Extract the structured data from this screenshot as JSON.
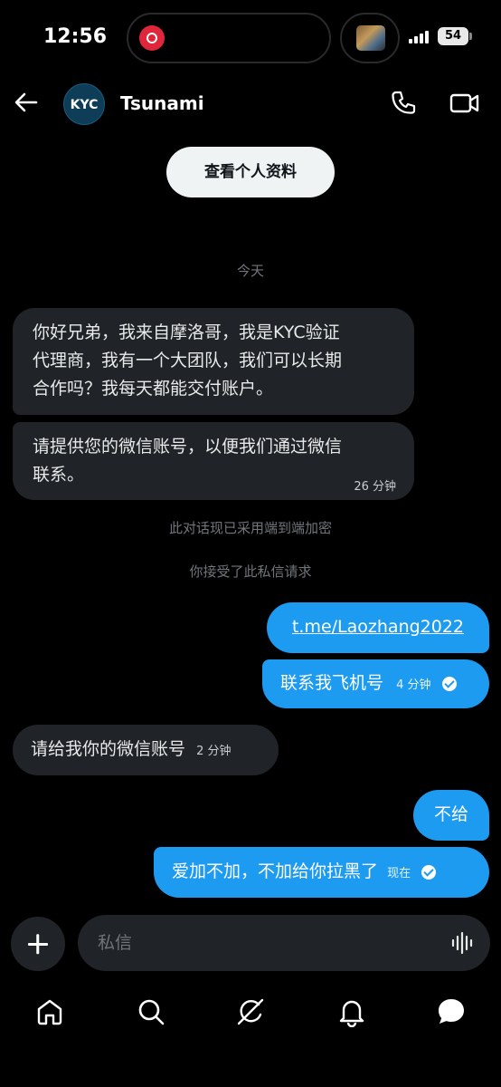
{
  "status_bar": {
    "time": "12:56",
    "battery": "54"
  },
  "header": {
    "avatar_text": "KYC",
    "contact_name": "Tsunami"
  },
  "profile_button_label": "查看个人资料",
  "date_label": "今天",
  "messages": [
    {
      "direction": "in",
      "text": "你好兄弟，我来自摩洛哥，我是KYC验证代理商，我有一个大团队，我们可以长期合作吗？我每天都能交付账户。",
      "lines": [
        "你好兄弟，我来自摩洛哥，我是KYC验证",
        "代理商，我有一个大团队，我们可以长期",
        "合作吗？我每天都能交付账户。"
      ],
      "time": ""
    },
    {
      "direction": "in",
      "text": "请提供您的微信账号，以便我们通过微信联系。",
      "lines": [
        "请提供您的微信账号，以便我们通过微信",
        "联系。"
      ],
      "time": "26 分钟"
    },
    {
      "direction": "out",
      "text": "t.me/Laozhang2022",
      "time": ""
    },
    {
      "direction": "out",
      "text": "联系我飞机号",
      "time": "4 分钟"
    },
    {
      "direction": "in",
      "text": "请给我你的微信账号",
      "time": "2 分钟"
    },
    {
      "direction": "out",
      "text": "不给",
      "time": ""
    },
    {
      "direction": "out",
      "text": "爱加不加，不加给你拉黑了",
      "time": "现在"
    }
  ],
  "system_notices": {
    "encryption": "此对话现已采用端到端加密",
    "accepted": "你接受了此私信请求"
  },
  "composer": {
    "placeholder": "私信"
  },
  "bottom_nav": [
    "home-icon",
    "search-icon",
    "grok-icon",
    "notifications-icon",
    "messages-icon"
  ],
  "colors": {
    "accent": "#1d9bf0",
    "incoming_bubble": "#202327",
    "background": "#000000"
  }
}
